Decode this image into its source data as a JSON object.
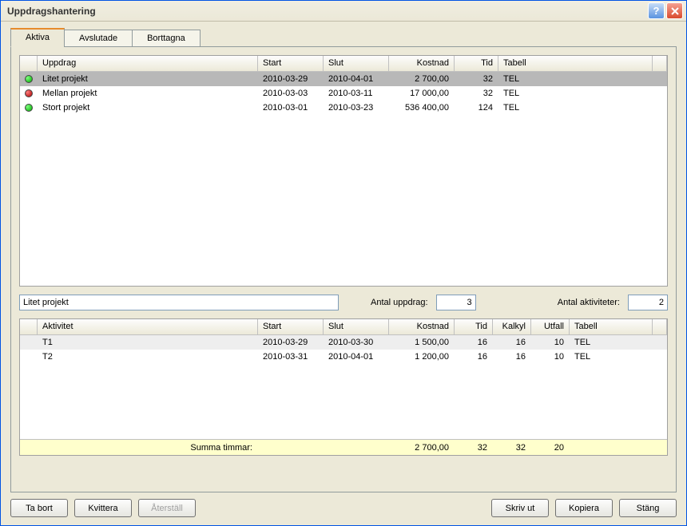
{
  "window": {
    "title": "Uppdragshantering"
  },
  "tabs": [
    {
      "label": "Aktiva"
    },
    {
      "label": "Avslutade"
    },
    {
      "label": "Borttagna"
    }
  ],
  "upperGrid": {
    "headers": {
      "uppdrag": "Uppdrag",
      "start": "Start",
      "slut": "Slut",
      "kostnad": "Kostnad",
      "tid": "Tid",
      "tabell": "Tabell"
    },
    "rows": [
      {
        "status": "green",
        "uppdrag": "Litet projekt",
        "start": "2010-03-29",
        "slut": "2010-04-01",
        "kostnad": "2 700,00",
        "tid": "32",
        "tabell": "TEL"
      },
      {
        "status": "red",
        "uppdrag": "Mellan projekt",
        "start": "2010-03-03",
        "slut": "2010-03-11",
        "kostnad": "17 000,00",
        "tid": "32",
        "tabell": "TEL"
      },
      {
        "status": "green",
        "uppdrag": "Stort projekt",
        "start": "2010-03-01",
        "slut": "2010-03-23",
        "kostnad": "536 400,00",
        "tid": "124",
        "tabell": "TEL"
      }
    ]
  },
  "midRow": {
    "selectedName": "Litet projekt",
    "antalUppdragLabel": "Antal uppdrag:",
    "antalUppdrag": "3",
    "antalAktiviteterLabel": "Antal aktiviteter:",
    "antalAktiviteter": "2"
  },
  "lowerGrid": {
    "headers": {
      "aktivitet": "Aktivitet",
      "start": "Start",
      "slut": "Slut",
      "kostnad": "Kostnad",
      "tid": "Tid",
      "kalkyl": "Kalkyl",
      "utfall": "Utfall",
      "tabell": "Tabell"
    },
    "rows": [
      {
        "aktivitet": "T1",
        "start": "2010-03-29",
        "slut": "2010-03-30",
        "kostnad": "1 500,00",
        "tid": "16",
        "kalkyl": "16",
        "utfall": "10",
        "tabell": "TEL"
      },
      {
        "aktivitet": "T2",
        "start": "2010-03-31",
        "slut": "2010-04-01",
        "kostnad": "1 200,00",
        "tid": "16",
        "kalkyl": "16",
        "utfall": "10",
        "tabell": "TEL"
      }
    ],
    "sum": {
      "label": "Summa timmar:",
      "kostnad": "2 700,00",
      "tid": "32",
      "kalkyl": "32",
      "utfall": "20"
    }
  },
  "buttons": {
    "taBort": "Ta bort",
    "kvittera": "Kvittera",
    "aterstall": "Återställ",
    "skrivUt": "Skriv ut",
    "kopiera": "Kopiera",
    "stang": "Stäng"
  }
}
